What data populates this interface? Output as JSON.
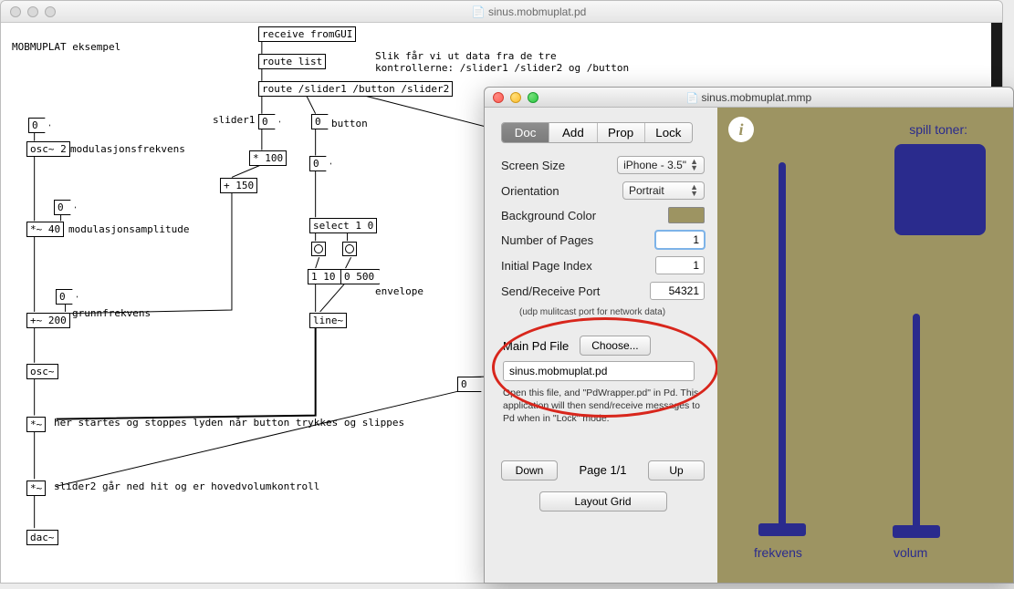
{
  "pd": {
    "title": "sinus.mobmuplat.pd",
    "heading": "MOBMUPLAT eksempel",
    "comment_right_1": "Slik får vi ut data fra de tre",
    "comment_right_2": "kontrollerne: /slider1 /slider2 og /button",
    "boxes": {
      "recv": "receive fromGUI",
      "routelist": "route list",
      "routesliders": "route /slider1 /button /slider2",
      "slider1_lbl": "slider1",
      "button_lbl": "button",
      "slider2_lbl": "slider2",
      "times100": "* 100",
      "plus150": "+ 150",
      "select10": "select 1 0",
      "msg_1_10": "1 10",
      "msg_0_500": "0 500",
      "envelope": "envelope",
      "line": "line~",
      "osc2": "osc~ 2",
      "modfreq": "modulasjonsfrekvens",
      "times40": "*~ 40",
      "modamp": "modulasjonsamplitude",
      "plus200": "+~ 200",
      "grunn": "grunnfrekvens",
      "osc": "osc~",
      "mul1": "*~",
      "comment_start": "her startes og stoppes lyden når button trykkes og slippes",
      "mul2": "*~",
      "comment_vol": "slider2 går ned hit og er hovedvolumkontroll",
      "dac": "dac~"
    },
    "numboxes": {
      "n_slider1": "0",
      "n_button": "0",
      "n_slider2": "0",
      "n_top1": "0",
      "n_amp": "0",
      "n_grunn": "0",
      "n_line_in": "0",
      "n_big0": "0"
    }
  },
  "editor": {
    "title": "sinus.mobmuplat.mmp",
    "tabs": [
      "Doc",
      "Add",
      "Prop",
      "Lock"
    ],
    "active_tab": 0,
    "screen_size_label": "Screen Size",
    "screen_size_value": "iPhone - 3.5\"",
    "orientation_label": "Orientation",
    "orientation_value": "Portrait",
    "bgcolor_label": "Background Color",
    "bgcolor_value": "#9d9462",
    "numpages_label": "Number of Pages",
    "numpages_value": "1",
    "initpage_label": "Initial Page Index",
    "initpage_value": "1",
    "port_label": "Send/Receive Port",
    "port_value": "54321",
    "port_hint": "(udp mulitcast port for network data)",
    "mainpd_label": "Main Pd File",
    "choose_label": "Choose...",
    "file_value": "sinus.mobmuplat.pd",
    "explain": "Open this file, and \"PdWrapper.pd\" in Pd. This application will then send/receive messages to Pd when in \"Lock\" mode.",
    "down": "Down",
    "up": "Up",
    "pager": "Page 1/1",
    "layoutgrid": "Layout Grid",
    "device": {
      "title": "spill toner:",
      "freq": "frekvens",
      "volum": "volum"
    }
  }
}
